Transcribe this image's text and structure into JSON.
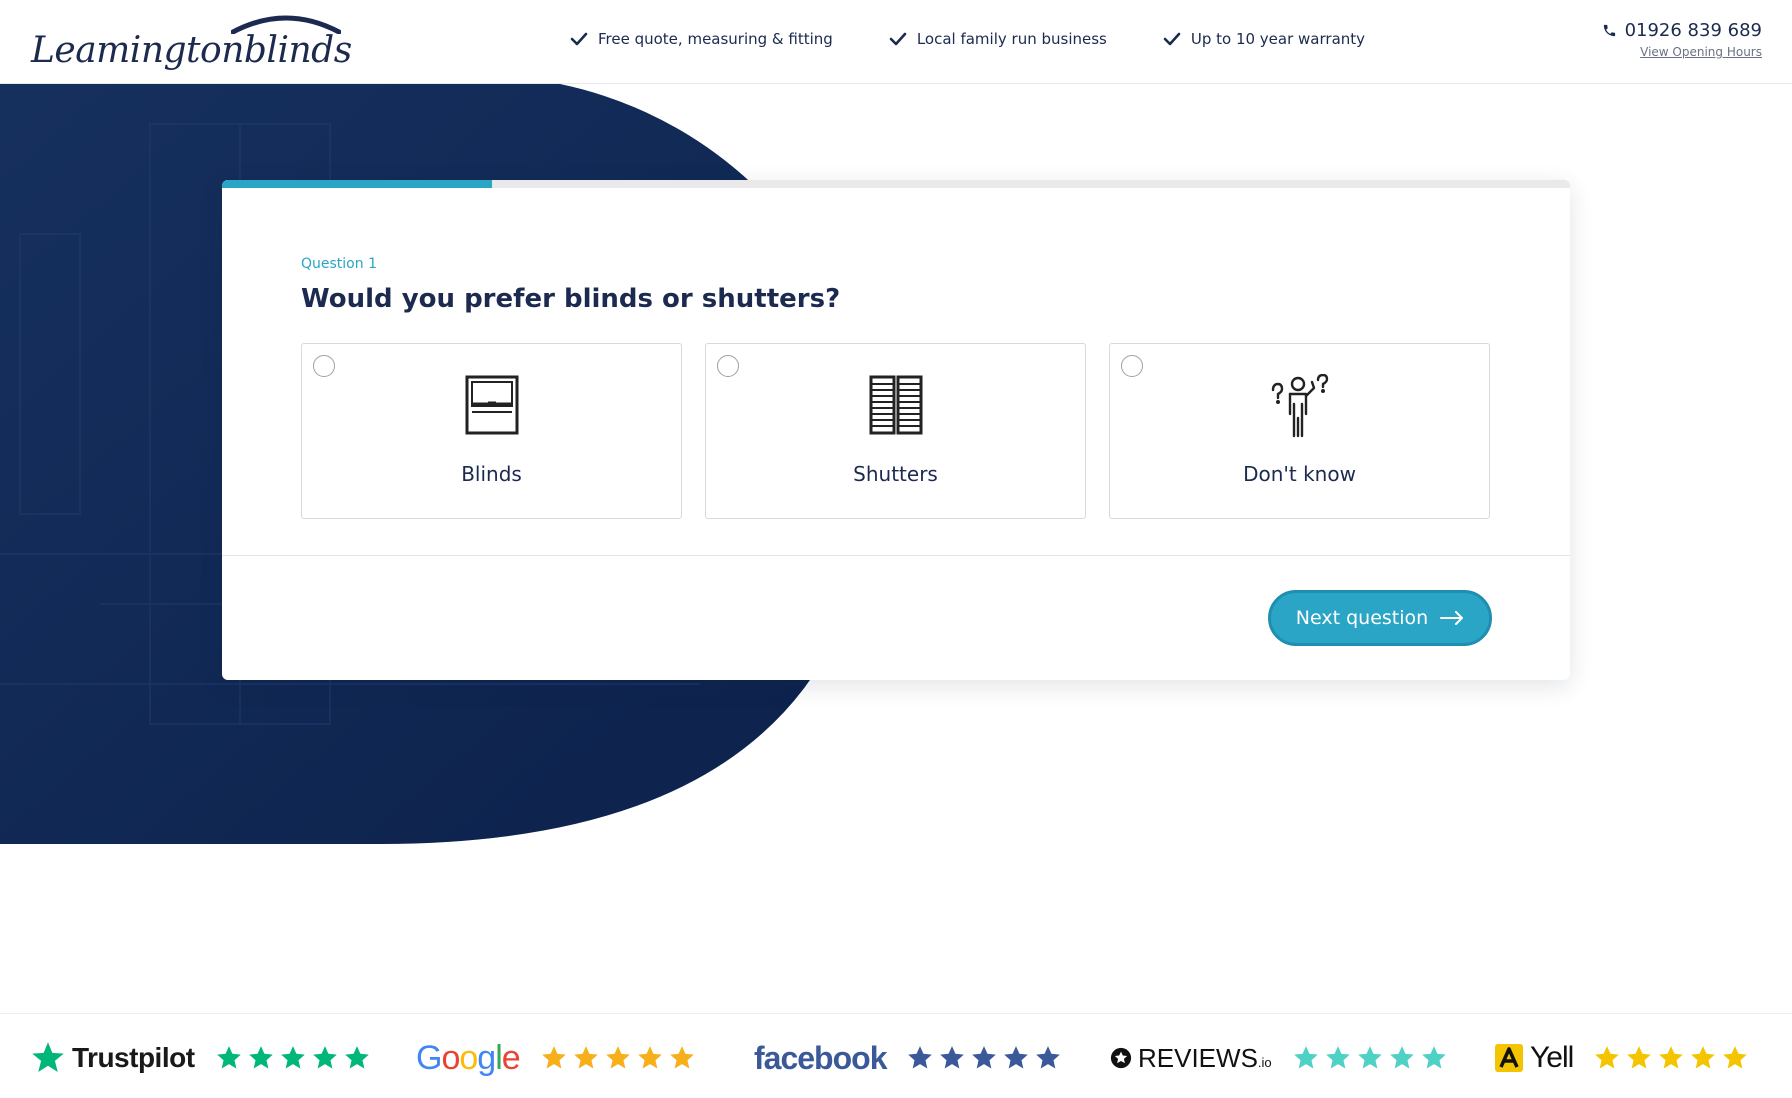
{
  "header": {
    "logo_word1": "Leamington",
    "logo_word2": "blinds",
    "usps": [
      {
        "label": "Free quote, measuring & fitting"
      },
      {
        "label": "Local family run business"
      },
      {
        "label": "Up to 10 year warranty"
      }
    ],
    "phone": "01926 839 689",
    "hours_link": "View Opening Hours"
  },
  "colors": {
    "navy": "#1b2a4e",
    "accent": "#2aa5c6",
    "hero_bg": "#0f2550"
  },
  "quiz": {
    "progress_fraction": 0.2,
    "question_label": "Question 1",
    "question_title": "Would you prefer blinds or shutters?",
    "options": [
      {
        "label": "Blinds",
        "icon": "blind-icon",
        "selected": false
      },
      {
        "label": "Shutters",
        "icon": "shutters-icon",
        "selected": false
      },
      {
        "label": "Don't know",
        "icon": "confused-person-icon",
        "selected": false
      }
    ],
    "next_label": "Next question"
  },
  "reviews": [
    {
      "name": "Trustpilot",
      "stars": 5,
      "star_color": "#00b67a"
    },
    {
      "name": "Google",
      "stars": 5,
      "star_color": "#f6b01e"
    },
    {
      "name": "facebook",
      "stars": 5,
      "star_color": "#3b5998"
    },
    {
      "name": "REVIEWS",
      "suffix": ".io",
      "stars": 5,
      "star_color": "#4fd1c5"
    },
    {
      "name": "Yell",
      "stars": 5,
      "star_color": "#f5c400"
    }
  ]
}
